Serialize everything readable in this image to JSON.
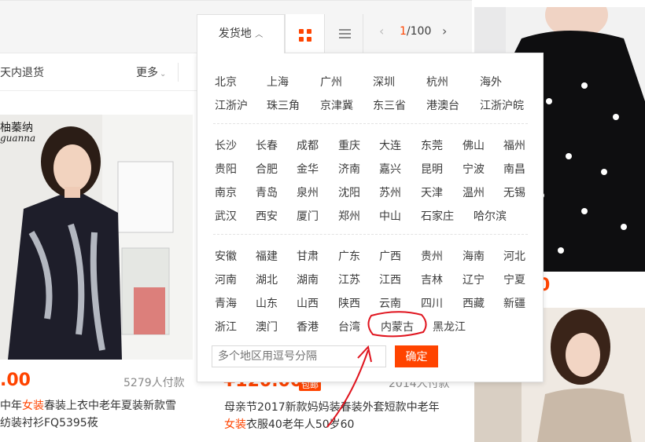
{
  "toolbar": {
    "ship_from_label": "发货地",
    "page_current": "1",
    "page_total": "/100"
  },
  "filters": {
    "seven_day_return": "天内退货",
    "more": "更多"
  },
  "ship_panel": {
    "group1": [
      "北京",
      "上海",
      "广州",
      "深圳",
      "杭州",
      "海外",
      "江浙沪",
      "珠三角",
      "京津冀",
      "东三省",
      "港澳台",
      "江浙沪皖"
    ],
    "group2": [
      "长沙",
      "长春",
      "成都",
      "重庆",
      "大连",
      "东莞",
      "佛山",
      "福州",
      "贵阳",
      "合肥",
      "金华",
      "济南",
      "嘉兴",
      "昆明",
      "宁波",
      "南昌",
      "南京",
      "青岛",
      "泉州",
      "沈阳",
      "苏州",
      "天津",
      "温州",
      "无锡",
      "武汉",
      "西安",
      "厦门",
      "郑州",
      "中山",
      "石家庄",
      "哈尔滨"
    ],
    "group3": [
      "安徽",
      "福建",
      "甘肃",
      "广东",
      "广西",
      "贵州",
      "海南",
      "河北",
      "河南",
      "湖北",
      "湖南",
      "江苏",
      "江西",
      "吉林",
      "辽宁",
      "宁夏",
      "青海",
      "山东",
      "山西",
      "陕西",
      "云南",
      "四川",
      "西藏",
      "新疆",
      "浙江",
      "澳门",
      "香港",
      "台湾",
      "内蒙古",
      "黑龙江"
    ],
    "multi_placeholder": "多个地区用逗号分隔",
    "confirm_label": "确定"
  },
  "products": {
    "left": {
      "brand": "柚蓁纳",
      "brand_en": "guanna",
      "price": ".00",
      "paid": "5279人付款",
      "title_pre": "中年",
      "title_hl": "女装",
      "title_post": "春装上衣中老年夏装新款雪",
      "title_line2": "纺装衬衫FQ5395莜"
    },
    "middle": {
      "price": "¥120.00",
      "badge": "包邮",
      "paid": "2014人付款",
      "title_line1": "母亲节2017新款妈妈装春装外套短款中老年",
      "title_hl": "女装",
      "title_line2_post": "衣服40老年人50岁60"
    },
    "right_top": {
      "price": "0"
    }
  },
  "colors": {
    "accent": "#ff4400",
    "annotation": "#e0141e"
  }
}
